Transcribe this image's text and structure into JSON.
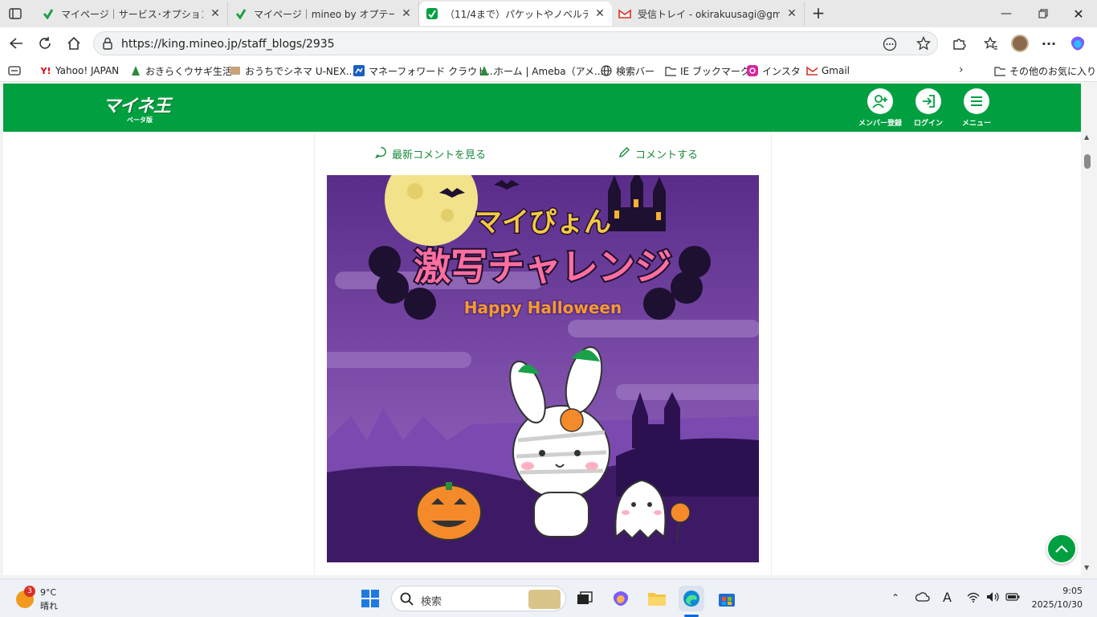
{
  "browser": {
    "tabs": [
      {
        "title": "マイページ｜サービス･オプション｜格安",
        "active": false
      },
      {
        "title": "マイページ｜mineo by オプテージ",
        "active": false
      },
      {
        "title": "（11/4まで）パケットやノベルティをゲ",
        "active": true
      },
      {
        "title": "受信トレイ - okirakuusagi@gmail.c",
        "active": false
      }
    ],
    "url": "https://king.mineo.jp/staff_blogs/2935",
    "bookmarks": [
      "Yahoo! JAPAN",
      "おきらくウサギ生活",
      "おうちでシネマ U-NEX...",
      "マネーフォワード クラウド...",
      "ホーム | Ameba（アメ...",
      "検索バー",
      "IE ブックマーク",
      "インスタ",
      "Gmail"
    ],
    "other_bookmarks": "その他のお気に入り"
  },
  "site": {
    "logo": "マイネ王",
    "logo_sub": "ベータ版",
    "header_buttons": {
      "register": "メンバー登録",
      "login": "ログイン",
      "menu": "メニュー"
    },
    "links": {
      "latest_comments": "最新コメントを見る",
      "comment": "コメントする"
    },
    "hero": {
      "title_top": "マイぴょん",
      "title_main": "激写チャレンジ",
      "subtitle": "Happy Halloween"
    }
  },
  "taskbar": {
    "weather_temp": "9°C",
    "weather_text": "晴れ",
    "weather_badge": "3",
    "search_placeholder": "検索",
    "time": "9:05",
    "date": "2025/10/30"
  },
  "colors": {
    "brand_green": "#00a040",
    "link_green": "#1a8a3c",
    "hero_purple": "#6b3a9a"
  }
}
